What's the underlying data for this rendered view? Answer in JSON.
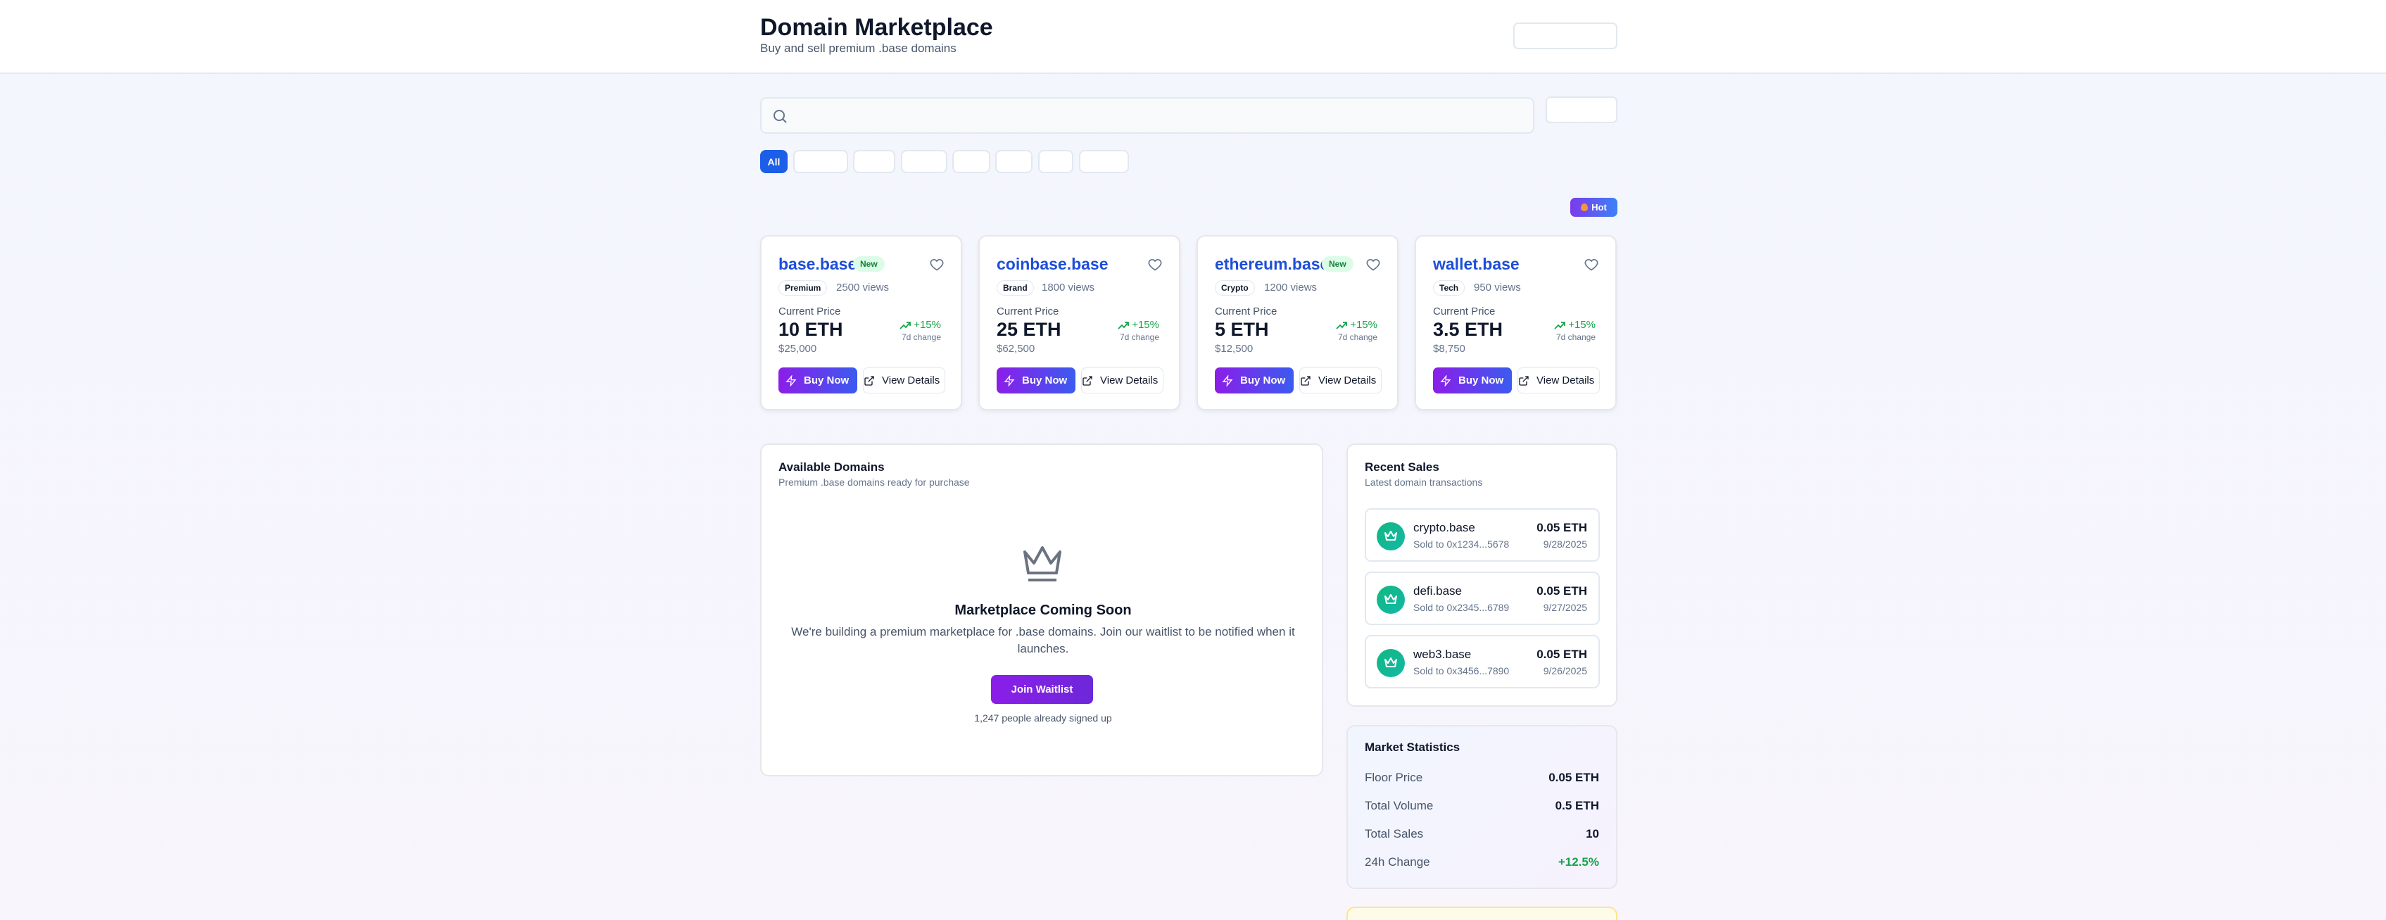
{
  "header": {
    "title": "Domain Marketplace",
    "subtitle": "Buy and sell premium .base domains"
  },
  "search": {
    "placeholder": ""
  },
  "filters": {
    "active_label": "All"
  },
  "hot_badge": "Hot",
  "cards": [
    {
      "name": "base.base",
      "badge": "New",
      "category": "Premium",
      "views": "2500 views",
      "price_label": "Current Price",
      "price": "10 ETH",
      "usd": "$25,000",
      "change": "+15%",
      "change_label": "7d change",
      "buy_label": "Buy Now",
      "details_label": "View Details"
    },
    {
      "name": "coinbase.base",
      "badge": "",
      "category": "Brand",
      "views": "1800 views",
      "price_label": "Current Price",
      "price": "25 ETH",
      "usd": "$62,500",
      "change": "+15%",
      "change_label": "7d change",
      "buy_label": "Buy Now",
      "details_label": "View Details"
    },
    {
      "name": "ethereum.base",
      "badge": "New",
      "category": "Crypto",
      "views": "1200 views",
      "price_label": "Current Price",
      "price": "5 ETH",
      "usd": "$12,500",
      "change": "+15%",
      "change_label": "7d change",
      "buy_label": "Buy Now",
      "details_label": "View Details"
    },
    {
      "name": "wallet.base",
      "badge": "",
      "category": "Tech",
      "views": "950 views",
      "price_label": "Current Price",
      "price": "3.5 ETH",
      "usd": "$8,750",
      "change": "+15%",
      "change_label": "7d change",
      "buy_label": "Buy Now",
      "details_label": "View Details"
    }
  ],
  "available": {
    "title": "Available Domains",
    "subtitle": "Premium .base domains ready for purchase",
    "soon_title": "Marketplace Coming Soon",
    "soon_desc": "We're building a premium marketplace for .base domains. Join our waitlist to be notified when it launches.",
    "waitlist_label": "Join Waitlist",
    "signed_up": "1,247 people already signed up"
  },
  "recent_sales": {
    "title": "Recent Sales",
    "subtitle": "Latest domain transactions",
    "items": [
      {
        "name": "crypto.base",
        "to": "Sold to 0x1234...5678",
        "price": "0.05 ETH",
        "date": "9/28/2025"
      },
      {
        "name": "defi.base",
        "to": "Sold to 0x2345...6789",
        "price": "0.05 ETH",
        "date": "9/27/2025"
      },
      {
        "name": "web3.base",
        "to": "Sold to 0x3456...7890",
        "price": "0.05 ETH",
        "date": "9/26/2025"
      }
    ]
  },
  "stats": {
    "title": "Market Statistics",
    "rows": [
      {
        "label": "Floor Price",
        "value": "0.05 ETH"
      },
      {
        "label": "Total Volume",
        "value": "0.5 ETH"
      },
      {
        "label": "Total Sales",
        "value": "10"
      },
      {
        "label": "24h Change",
        "value": "+12.5%"
      }
    ]
  },
  "colors": {
    "accent_blue": "#1d5ee8",
    "link_blue": "#1d4ed8",
    "buy_gradient_start": "#8b1ee8",
    "buy_gradient_end": "#3b5bf0",
    "positive_green": "#16a34a"
  }
}
